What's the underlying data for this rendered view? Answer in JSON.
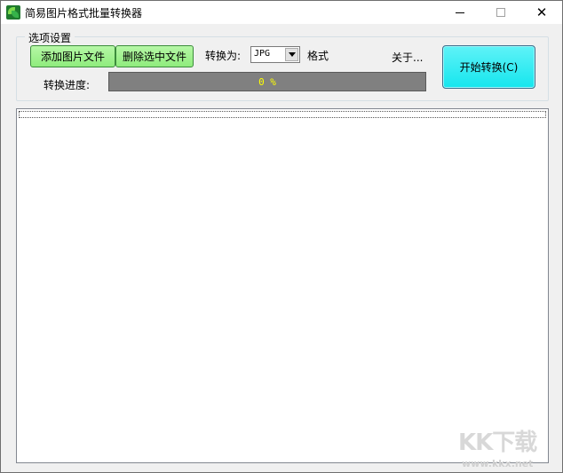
{
  "window": {
    "title": "简易图片格式批量转换器",
    "close_symbol": "✕"
  },
  "options": {
    "group_label": "选项设置",
    "add_button": "添加图片文件",
    "delete_button": "删除选中文件",
    "convert_to_label": "转换为:",
    "format_value": "JPG",
    "format_suffix": "格式",
    "about_link": "关于...",
    "progress_label": "转换进度:",
    "progress_value": 0,
    "progress_text": "0 %",
    "start_button": "开始转换(C)"
  },
  "file_list": {
    "items": []
  },
  "watermark": {
    "brand": "KK下载",
    "url": "www.kkx.net"
  },
  "colors": {
    "green_button": "#9ef28e",
    "start_button": "#2ce9f0",
    "progress_bg": "#808080",
    "progress_text": "#ffff00"
  }
}
